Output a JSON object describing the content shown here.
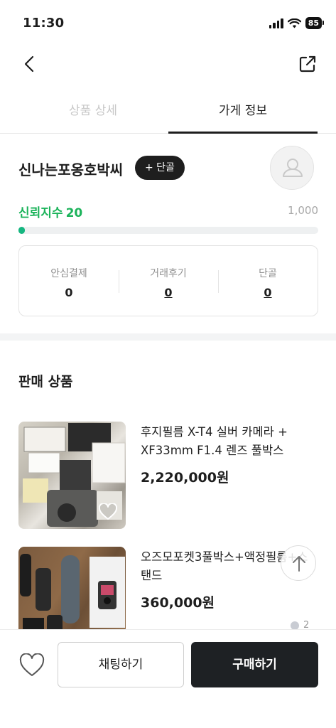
{
  "status_bar": {
    "time": "11:30",
    "battery": "85"
  },
  "tabs": [
    {
      "label": "상품 상세",
      "active": false
    },
    {
      "label": "가게 정보",
      "active": true
    }
  ],
  "store": {
    "name": "신나는포옹호박씨",
    "regular_button": "+ 단골",
    "trust_label": "신뢰지수",
    "trust_value": "20",
    "trust_max": "1,000",
    "trust_progress_fraction": 0.02,
    "stats": [
      {
        "label": "안심결제",
        "value": "0"
      },
      {
        "label": "거래후기",
        "value": "0"
      },
      {
        "label": "단골",
        "value": "0"
      }
    ]
  },
  "products_section": {
    "title": "판매 상품",
    "items": [
      {
        "name": "후지필름 X-T4 실버 카메라 + XF33mm F1.4 렌즈 풀박스",
        "price": "2,220,000원"
      },
      {
        "name": "오즈모포켓3풀박스+액정필름+스탠드",
        "price": "360,000원"
      }
    ]
  },
  "page_indicator": "2",
  "bottom_bar": {
    "chat_label": "채팅하기",
    "buy_label": "구매하기"
  },
  "colors": {
    "trust_green": "#1bb35a",
    "progress": "#15b680",
    "buy_button": "#1e2124"
  },
  "icons": [
    "back-arrow-icon",
    "share-icon",
    "user-icon",
    "heart-icon",
    "arrow-up-icon",
    "signal-icon",
    "wifi-icon",
    "battery-icon"
  ]
}
